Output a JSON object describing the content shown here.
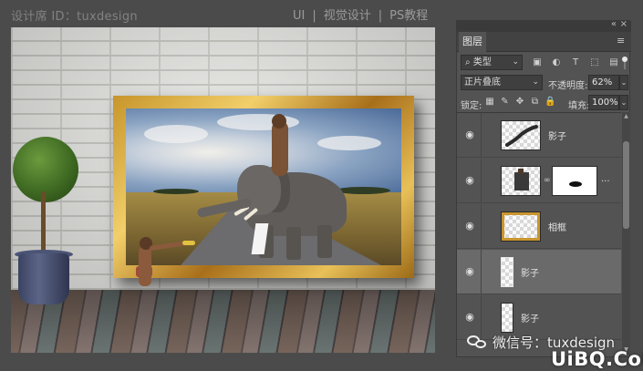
{
  "header": {
    "designer_id": "设计席 ID：tuxdesign",
    "crumb_ui": "UI",
    "crumb_sep1": "|",
    "crumb_visual": "视觉设计",
    "crumb_sep2": "|",
    "crumb_ps": "PS教程"
  },
  "panel": {
    "collapse_icon": "«",
    "close_icon": "×",
    "tab_layers": "图层",
    "menu_icon": "≡",
    "filter": {
      "search_glyph": "⌕",
      "label": "类型",
      "chevron": "⌄"
    },
    "filter_icons": [
      {
        "name": "pixel-layer-filter-icon",
        "glyph": "▣"
      },
      {
        "name": "adjustment-layer-filter-icon",
        "glyph": "◐"
      },
      {
        "name": "type-layer-filter-icon",
        "glyph": "T"
      },
      {
        "name": "shape-layer-filter-icon",
        "glyph": "⬚"
      },
      {
        "name": "smart-object-filter-icon",
        "glyph": "▤"
      }
    ],
    "blend_mode": {
      "value": "正片叠底",
      "chevron": "⌄"
    },
    "opacity": {
      "label": "不透明度:",
      "value": "62%",
      "chevron": "⌄"
    },
    "lock": {
      "label": "锁定:",
      "icons": [
        {
          "name": "lock-transparent-pixels-icon",
          "glyph": "▦"
        },
        {
          "name": "lock-image-pixels-icon",
          "glyph": "✎"
        },
        {
          "name": "lock-position-icon",
          "glyph": "✥"
        },
        {
          "name": "lock-artboard-icon",
          "glyph": "⧉"
        },
        {
          "name": "lock-all-icon",
          "glyph": "🔒"
        }
      ]
    },
    "fill": {
      "label": "填充:",
      "value": "100%",
      "chevron": "⌄"
    },
    "layers": [
      {
        "name": "影子",
        "selected": false,
        "type": "shadow-wide"
      },
      {
        "name": "",
        "selected": false,
        "type": "masked",
        "chain": "∞",
        "ellipsis": "..."
      },
      {
        "name": "相框",
        "selected": false,
        "type": "frame"
      },
      {
        "name": "影子",
        "selected": true,
        "type": "shadow-narrow"
      },
      {
        "name": "影子",
        "selected": false,
        "type": "shadow-narrow"
      }
    ],
    "eye_glyph": "◉",
    "scroll_up": "▲",
    "scroll_down": "▼"
  },
  "watermark": {
    "wechat": "微信号：tuxdesign",
    "uibq": "UiBQ.CoM"
  }
}
